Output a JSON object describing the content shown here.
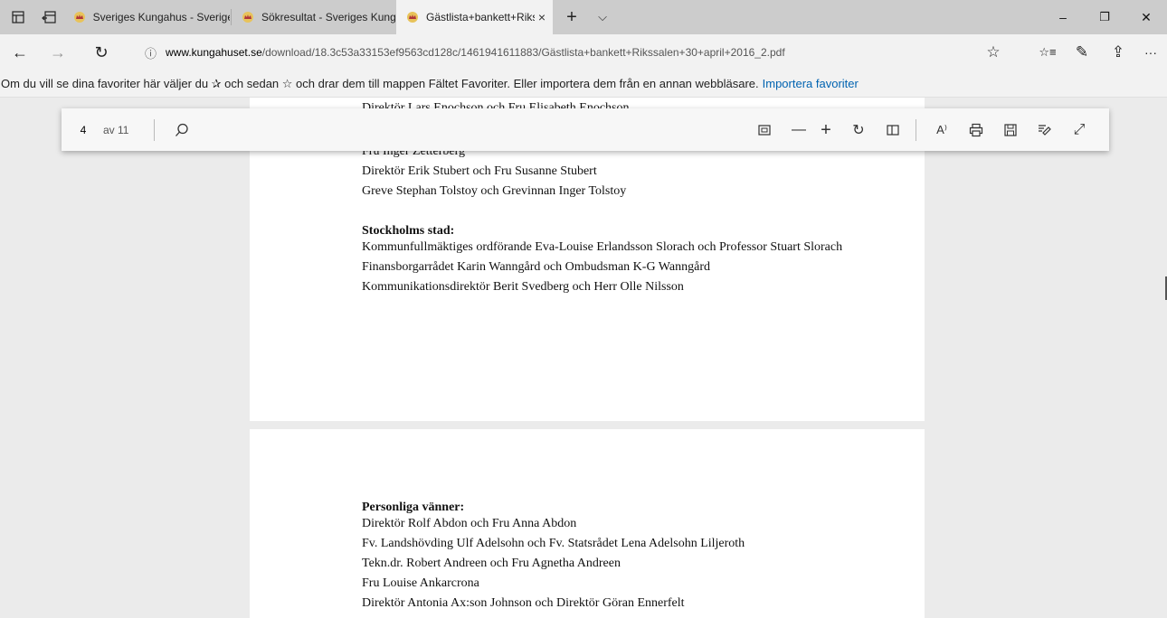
{
  "titlebar": {
    "tabs": [
      {
        "title": "Sveriges Kungahus - Sverige",
        "favicon": "crown-icon"
      },
      {
        "title": "Sökresultat - Sveriges Kung",
        "favicon": "crown-icon"
      },
      {
        "title": "Gästlista+bankett+Riks",
        "favicon": "crown-icon",
        "active": true
      }
    ],
    "new_tab_glyph": "+",
    "tab_list_glyph": "⌵",
    "close_glyph": "×",
    "minimize_glyph": "–",
    "restore_glyph": "❐",
    "close_window_glyph": "✕"
  },
  "navbar": {
    "back_glyph": "←",
    "forward_glyph": "→",
    "refresh_glyph": "↻",
    "info_glyph": "ⓘ",
    "domain": "www.kungahuset.se",
    "path": "/download/18.3c53a33153ef9563cd128c/1461941611883/Gästlista+bankett+Rikssalen+30+april+2016_2.pdf",
    "favorite_glyph": "☆",
    "favorites_list_glyph": "☆≡",
    "notes_glyph": "✎",
    "share_glyph": "⇪",
    "more_glyph": "···"
  },
  "favbar": {
    "text": "Om du vill se dina favoriter här väljer du ✰ och sedan ☆ och drar dem till mappen Fältet Favoriter. Eller importera dem från en annan webbläsare.",
    "link": "Importera favoriter"
  },
  "pdf_toolbar": {
    "page_number": "4",
    "page_of": "av 11",
    "search_glyph": "⌕",
    "fit_glyph": "⛶",
    "zoom_out_glyph": "—",
    "zoom_in_glyph": "+",
    "rotate_glyph": "↻",
    "layout_glyph": "◫",
    "read_aloud_glyph": "A⁾",
    "print_glyph": "⎙",
    "save_glyph": "💾",
    "annotate_glyph": "✐",
    "fullscreen_glyph": "⤢"
  },
  "page1": {
    "lines": [
      {
        "text": "Direktör Lars Enochson och Fru Elisabeth Enochson",
        "bold": false
      },
      {
        "text": "Fru Inger Zetterberg",
        "bold": false
      },
      {
        "text": "Direktör Erik Stubert och Fru Susanne Stubert",
        "bold": false
      },
      {
        "text": "Greve Stephan Tolstoy och Grevinnan Inger Tolstoy",
        "bold": false
      },
      {
        "text": "Stockholms stad:",
        "bold": true
      },
      {
        "text": "Kommunfullmäktiges ordförande Eva-Louise Erlandsson Slorach och Professor Stuart Slorach",
        "bold": false
      },
      {
        "text": "Finansborgarrådet Karin Wanngård och Ombudsman K-G Wanngård",
        "bold": false
      },
      {
        "text": "Kommunikationsdirektör Berit Svedberg och Herr Olle Nilsson",
        "bold": false
      }
    ]
  },
  "page2": {
    "lines": [
      {
        "text": "Personliga vänner:",
        "bold": true
      },
      {
        "text": "Direktör Rolf Abdon och Fru Anna Abdon",
        "bold": false
      },
      {
        "text": "Fv. Landshövding Ulf Adelsohn och Fv. Statsrådet Lena Adelsohn Liljeroth",
        "bold": false
      },
      {
        "text": "Tekn.dr. Robert Andreen och Fru Agnetha Andreen",
        "bold": false
      },
      {
        "text": "Fru Louise Ankarcrona",
        "bold": false
      },
      {
        "text": "Direktör Antonia Ax:son Johnson och Direktör Göran Ennerfelt",
        "bold": false
      }
    ]
  }
}
